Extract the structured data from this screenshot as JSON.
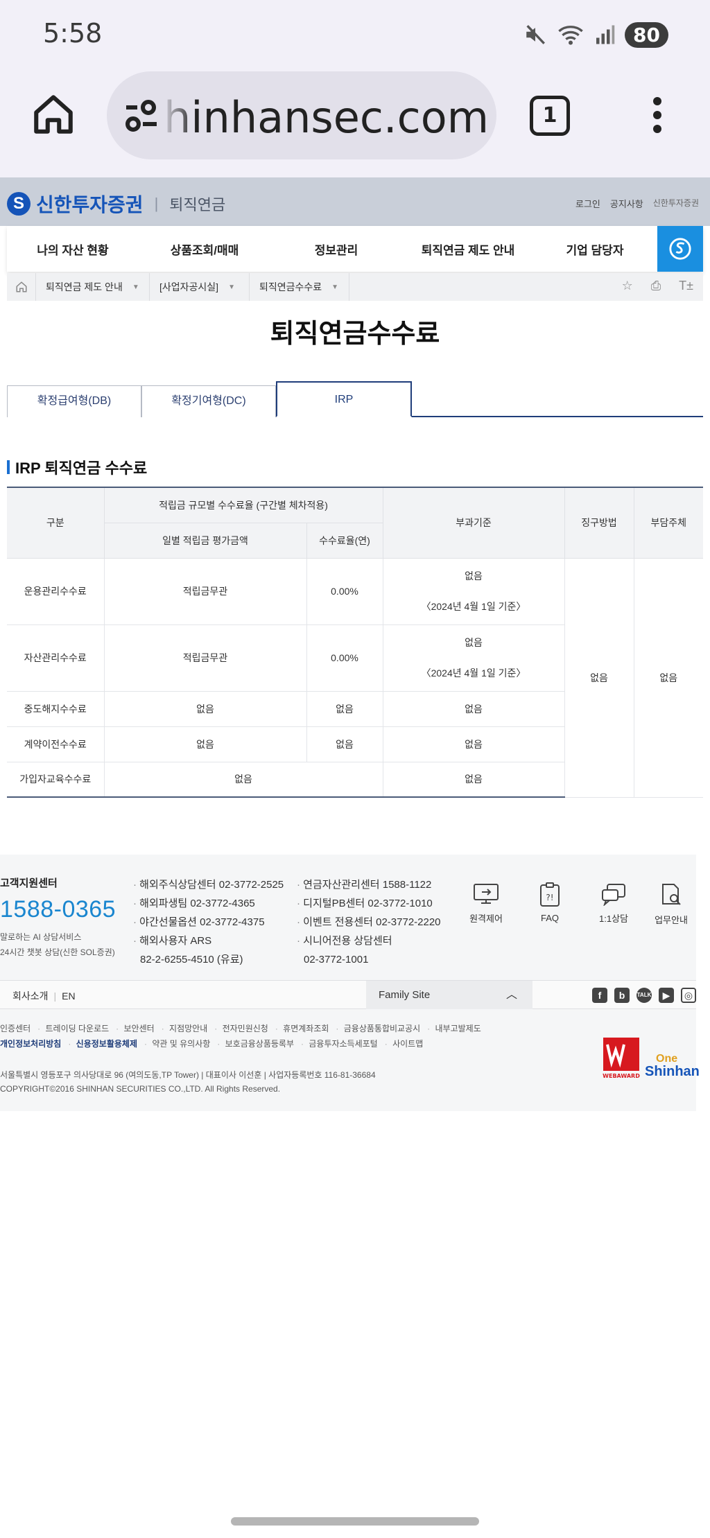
{
  "status": {
    "time": "5:58",
    "battery": "80"
  },
  "browser": {
    "url": "shinhansec.com",
    "url_visible": "hinhansec.com",
    "tab_count": "1"
  },
  "header": {
    "logo_text": "신한투자증권",
    "section": "퇴직연금",
    "top_links": [
      "로그인",
      "공지사항",
      "신한투자증권"
    ]
  },
  "gnb": {
    "items": [
      "나의 자산 현황",
      "상품조회/매매",
      "정보관리",
      "퇴직연금 제도 안내",
      "기업 담당자"
    ]
  },
  "breadcrumb": {
    "items": [
      "퇴직연금 제도 안내",
      "[사업자공시실]",
      "퇴직연금수수료"
    ]
  },
  "page": {
    "title": "퇴직연금수수료"
  },
  "tabs": [
    {
      "label": "확정급여형(DB)",
      "active": false
    },
    {
      "label": "확정기여형(DC)",
      "active": false
    },
    {
      "label": "IRP",
      "active": true
    }
  ],
  "section": {
    "title": "IRP 퇴직연금 수수료"
  },
  "table": {
    "headers": {
      "category": "구분",
      "group": "적립금 규모별 수수료율 (구간별 체차적용)",
      "amount": "일별 적립금 평가금액",
      "rate": "수수료율(연)",
      "basis": "부과기준",
      "method": "징구방법",
      "payer": "부담주체"
    },
    "rows": [
      {
        "name": "운용관리수수료",
        "amount": "적립금무관",
        "rate": "0.00%",
        "basis": "없음",
        "basis_note": "〈2024년 4월 1일 기준〉"
      },
      {
        "name": "자산관리수수료",
        "amount": "적립금무관",
        "rate": "0.00%",
        "basis": "없음",
        "basis_note": "〈2024년 4월 1일 기준〉"
      },
      {
        "name": "중도해지수수료",
        "amount": "없음",
        "rate": "없음",
        "basis": "없음"
      },
      {
        "name": "계약이전수수료",
        "amount": "없음",
        "rate": "없음",
        "basis": "없음"
      },
      {
        "name": "가입자교육수수료",
        "amount_rate": "없음",
        "basis": "없음"
      }
    ],
    "method": "없음",
    "payer": "없음"
  },
  "footer": {
    "cs_title": "고객지원센터",
    "cs_phone": "1588-0365",
    "cs_sub1": "말로하는 AI 상담서비스",
    "cs_sub2": "24시간 챗봇 상담(신한 SOL증권)",
    "col1": [
      "해외주식상담센터 02-3772-2525",
      "해외파생팀 02-3772-4365",
      "야간선물옵션 02-3772-4375",
      "해외사용자 ARS"
    ],
    "col1_extra": "82-2-6255-4510 (유료)",
    "col2": [
      "연금자산관리센터 1588-1122",
      "디지털PB센터 02-3772-1010",
      "이벤트 전용센터 02-3772-2220",
      "시니어전용 상담센터"
    ],
    "col2_extra": "02-3772-1001",
    "quick": [
      "원격제어",
      "FAQ",
      "1:1상담",
      "업무안내"
    ],
    "bar_links": [
      "회사소개",
      "EN"
    ],
    "family_site": "Family Site",
    "links1": [
      "인증센터",
      "트레이딩 다운로드",
      "보안센터",
      "지점망안내",
      "전자민원신청",
      "휴면계좌조회",
      "금융상품통합비교공시",
      "내부고발제도"
    ],
    "links2": [
      "개인정보처리방침",
      "신용정보활용체제",
      "약관 및 유의사항",
      "보호금융상품등록부",
      "금융투자소득세포털",
      "사이트맵"
    ],
    "address": "서울특별시 영등포구 의사당대로 96 (여의도동,TP Tower) | 대표이사 이선훈 | 사업자등록번호 116-81-36684",
    "copyright": "COPYRIGHT©2016 SHINHAN SECURITIES CO.,LTD. All Rights Reserved.",
    "award_text": "WEBAWARD",
    "one_shinhan_top": "One",
    "one_shinhan_bottom": "Shinhan"
  }
}
